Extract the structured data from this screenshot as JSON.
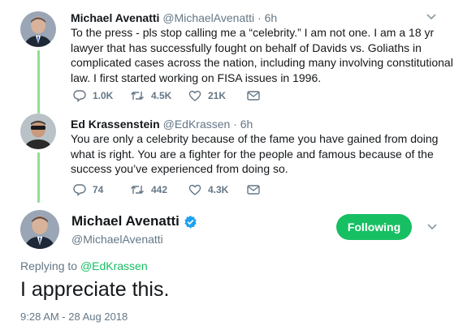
{
  "thread": [
    {
      "name": "Michael Avenatti",
      "handle": "@MichaelAvenatti",
      "dot": "·",
      "time": "6h",
      "text": "To the press - pls stop calling me a “celebrity.” I am not one. I am a 18 yr lawyer that has successfully fought on behalf of Davids vs. Goliaths in complicated cases across the nation, including many involving constitutional law. I first started working on FISA issues in 1996.",
      "replies": "1.0K",
      "retweets": "4.5K",
      "likes": "21K"
    },
    {
      "name": "Ed Krassenstein",
      "handle": "@EdKrassen",
      "dot": "·",
      "time": "6h",
      "text": "You are only a celebrity because of the fame you have gained from doing what is right.  You are a fighter for the people and famous because of the success you’ve experienced from doing so.",
      "replies": "74",
      "retweets": "442",
      "likes": "4.3K"
    }
  ],
  "main": {
    "name": "Michael Avenatti",
    "handle": "@MichaelAvenatti",
    "follow_label": "Following",
    "replying_prefix": "Replying to",
    "replying_to": "@EdKrassen",
    "text": "I appreciate this.",
    "timestamp": "9:28 AM - 28 Aug 2018"
  },
  "colors": {
    "accent": "#17bf63",
    "thread_line": "#8fe08f",
    "muted": "#657786",
    "verified": "#1da1f2"
  },
  "icons": {
    "reply": "reply-icon",
    "retweet": "retweet-icon",
    "like": "heart-icon",
    "message": "envelope-icon",
    "more": "chevron-down-icon",
    "verified": "verified-badge-icon"
  }
}
